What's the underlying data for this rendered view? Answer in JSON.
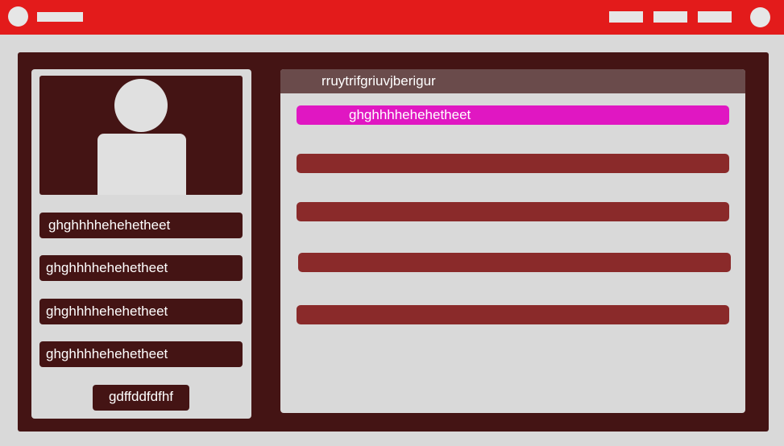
{
  "colors": {
    "topbar": "#e31b1b",
    "frame": "#441414",
    "panel": "#d9d9d9",
    "header": "#6a4b4b",
    "row": "#8a2a2a",
    "row_active": "#e017c2"
  },
  "sidebar": {
    "items": [
      {
        "label": "ghghhhhehehetheet"
      },
      {
        "label": "ghghhhhehehetheet"
      },
      {
        "label": "ghghhhhehehetheet"
      },
      {
        "label": "ghghhhhehehetheet"
      }
    ],
    "button_label": "gdffddfdfhf"
  },
  "main": {
    "header_title": "rruytrifgriuvjberigur",
    "rows": [
      {
        "label": "ghghhhhehehetheet",
        "active": true
      },
      {
        "label": "",
        "active": false
      },
      {
        "label": "",
        "active": false
      },
      {
        "label": "",
        "active": false
      },
      {
        "label": "",
        "active": false
      }
    ]
  }
}
